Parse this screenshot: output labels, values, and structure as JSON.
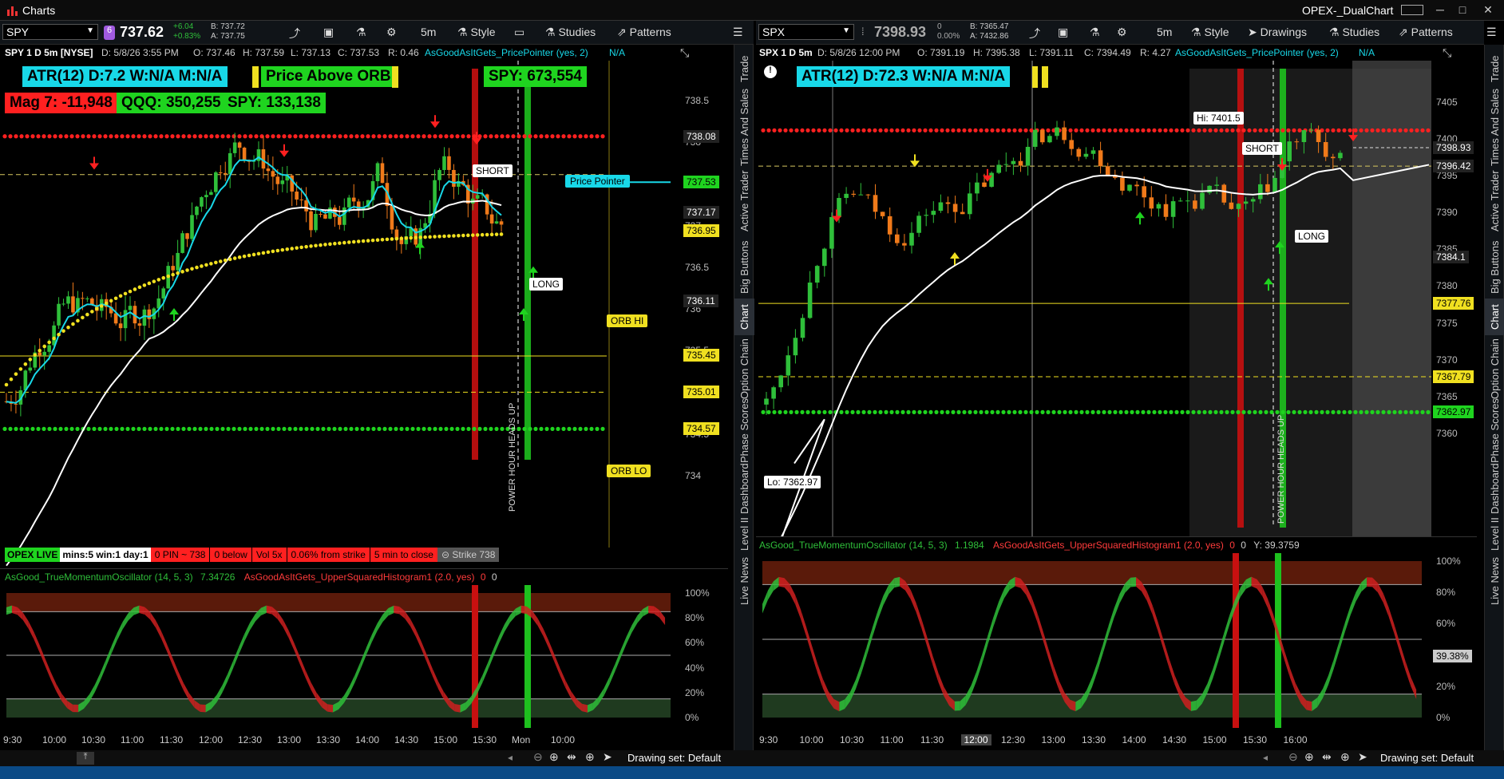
{
  "app": {
    "title": "Charts",
    "window_title": "OPEX-_DualChart"
  },
  "left": {
    "symbol": "SPY",
    "price": "737.62",
    "change": "+6.04",
    "change_pct": "+0.83%",
    "bid": "B: 737.72",
    "ask": "A: 737.75",
    "interval": "5m",
    "style_label": "Style",
    "studies_label": "Studies",
    "patterns_label": "Patterns",
    "info": {
      "title": "SPY 1 D 5m [NYSE]",
      "date": "D: 5/8/26 3:55 PM",
      "open": "O: 737.46",
      "high": "H: 737.59",
      "low": "L: 737.13",
      "close": "C: 737.53",
      "range": "R: 0.46",
      "study": "AsGoodAsItGets_PricePointer (yes, 2)",
      "na": "N/A"
    },
    "badges": {
      "atr": "ATR(12) D:7.2 W:N/A M:N/A",
      "orb": "Price Above ORB",
      "spy_top": "SPY: 673,554",
      "mag7": "Mag 7: -11,948",
      "qqq": "QQQ: 350,255",
      "spy": "SPY: 133,138"
    },
    "annotations": {
      "short": "SHORT",
      "long": "LONG",
      "price_pointer": "Price Pointer",
      "orb_hi": "ORB HI",
      "orb_lo": "ORB LO",
      "power_hour": "POWER HOUR HEADS UP"
    },
    "yaxis": {
      "ticks": [
        "738.5",
        "738",
        "737.5",
        "737",
        "736.5",
        "736",
        "735.5",
        "735",
        "734.5",
        "734"
      ]
    },
    "price_tags": [
      {
        "value": "738.08",
        "bg": "#222",
        "color": "#fff"
      },
      {
        "value": "737.53",
        "bg": "#1fd41f",
        "color": "#000"
      },
      {
        "value": "737.17",
        "bg": "#222",
        "color": "#fff"
      },
      {
        "value": "736.95",
        "bg": "#f0e020",
        "color": "#000"
      },
      {
        "value": "736.11",
        "bg": "#222",
        "color": "#fff"
      },
      {
        "value": "735.45",
        "bg": "#f0e020",
        "color": "#000"
      },
      {
        "value": "735.01",
        "bg": "#f0e020",
        "color": "#000"
      },
      {
        "value": "734.57",
        "bg": "#f0e020",
        "color": "#000"
      }
    ],
    "opex": {
      "live": "OPEX LIVE",
      "mins": "mins:5 win:1 day:1",
      "pin": "0 PIN ~ 738",
      "below": "0 below",
      "vol": "Vol 5x",
      "from_strike": "0.06% from strike",
      "to_close": "5 min to close",
      "strike": "Strike 738"
    },
    "osc": {
      "name": "AsGood_TrueMomentumOscillator (14, 5, 3)",
      "value": "7.34726",
      "hist": "AsGoodAsItGets_UpperSquaredHistogram1 (2.0, yes)",
      "v1": "0",
      "v2": "0",
      "ticks": [
        "100%",
        "80%",
        "60%",
        "40%",
        "20%",
        "0%"
      ]
    },
    "xaxis": [
      "9:30",
      "10:00",
      "10:30",
      "11:00",
      "11:30",
      "12:00",
      "12:30",
      "13:00",
      "13:30",
      "14:00",
      "14:30",
      "15:00",
      "15:30",
      "Mon",
      "10:00"
    ],
    "drawing_set": "Drawing set: Default"
  },
  "right": {
    "symbol": "SPX",
    "price": "7398.93",
    "change": "0",
    "change_pct": "0.00%",
    "bid": "B: 7365.47",
    "ask": "A: 7432.86",
    "interval": "5m",
    "style_label": "Style",
    "drawings_label": "Drawings",
    "studies_label": "Studies",
    "patterns_label": "Patterns",
    "info": {
      "title": "SPX 1 D 5m",
      "date": "D: 5/8/26 12:00 PM",
      "open": "O: 7391.19",
      "high": "H: 7395.38",
      "low": "L: 7391.11",
      "close": "C: 7394.49",
      "range": "R: 4.27",
      "study": "AsGoodAsItGets_PricePointer (yes, 2)",
      "na": "N/A"
    },
    "badges": {
      "atr": "ATR(12) D:72.3 W:N/A M:N/A"
    },
    "annotations": {
      "short": "SHORT",
      "long": "LONG",
      "hi": "Hi: 7401.5",
      "lo": "Lo: 7362.97",
      "power_hour": "POWER HOUR HEADS UP"
    },
    "yaxis": {
      "ticks": [
        "7405",
        "7400",
        "7395",
        "7390",
        "7385",
        "7380",
        "7375",
        "7370",
        "7365",
        "7360"
      ]
    },
    "price_tags": [
      {
        "value": "7398.93",
        "bg": "#222",
        "color": "#fff"
      },
      {
        "value": "7396.42",
        "bg": "#222",
        "color": "#fff"
      },
      {
        "value": "7384.1",
        "bg": "#222",
        "color": "#fff"
      },
      {
        "value": "7377.76",
        "bg": "#f0e020",
        "color": "#000"
      },
      {
        "value": "7367.79",
        "bg": "#f0e020",
        "color": "#000"
      },
      {
        "value": "7362.97",
        "bg": "#1fd41f",
        "color": "#000"
      }
    ],
    "osc": {
      "name": "AsGood_TrueMomentumOscillator (14, 5, 3)",
      "value": "1.1984",
      "hist": "AsGoodAsItGets_UpperSquaredHistogram1 (2.0, yes)",
      "v1": "0",
      "v2": "0",
      "y": "Y: 39.3759",
      "cursor_tag": "39.38%",
      "ticks": [
        "100%",
        "80%",
        "60%",
        "40%",
        "20%",
        "0%"
      ]
    },
    "xaxis": [
      "9:30",
      "10:00",
      "10:30",
      "11:00",
      "11:30",
      "12:00",
      "12:30",
      "13:00",
      "13:30",
      "14:00",
      "14:30",
      "15:00",
      "15:30",
      "16:00"
    ],
    "drawing_set": "Drawing set: Default"
  },
  "side_tabs": [
    "Trade",
    "Times And Sales",
    "Active Trader",
    "Big Buttons",
    "Chart",
    "Option Chain",
    "Phase Scores",
    "Dashboard",
    "Level II",
    "Live News"
  ],
  "colors": {
    "up": "#2fbf3a",
    "down": "#f07a1a",
    "red_line": "#ff2020",
    "green_line": "#1fd41f",
    "yellow": "#f0e020",
    "cyan": "#18d8e8"
  }
}
